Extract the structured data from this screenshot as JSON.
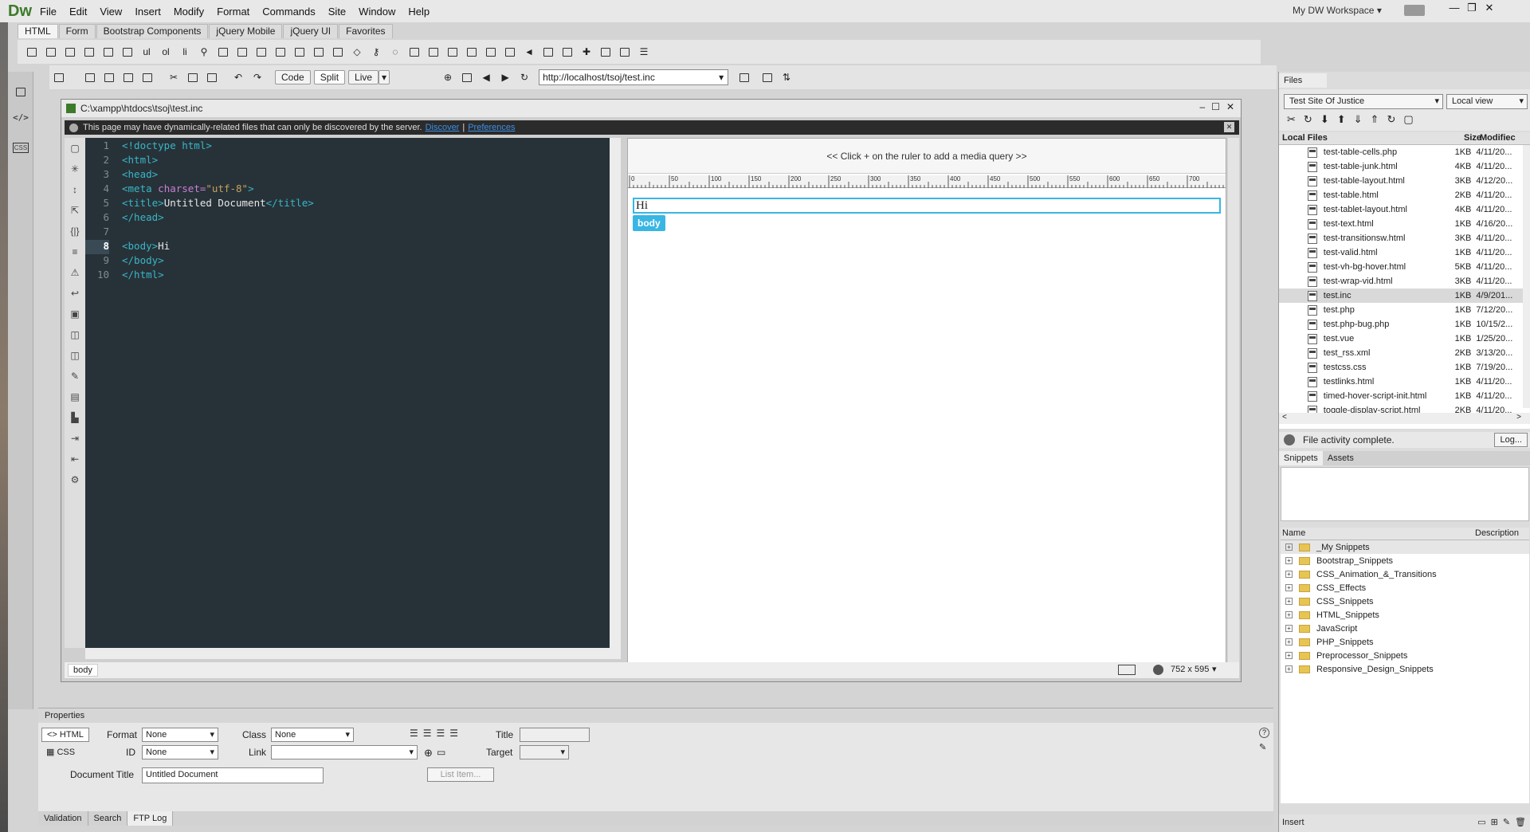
{
  "app": {
    "logo": "Dw",
    "workspace": "My DW Workspace"
  },
  "menu": [
    "File",
    "Edit",
    "View",
    "Insert",
    "Modify",
    "Format",
    "Commands",
    "Site",
    "Window",
    "Help"
  ],
  "insert_tabs": [
    "HTML",
    "Form",
    "Bootstrap Components",
    "jQuery Mobile",
    "jQuery UI",
    "Favorites"
  ],
  "insert_icons": {
    "ul": "ul",
    "ol": "ol",
    "li": "li"
  },
  "doc_toolbar": {
    "code": "Code",
    "split": "Split",
    "live": "Live",
    "url": "http://localhost/tsoj/test.inc"
  },
  "doc_window": {
    "path": "C:\\xampp\\htdocs\\tsoj\\test.inc",
    "info_text": "This page may have dynamically-related files that can only be discovered by the server.",
    "discover": "Discover",
    "sep": "|",
    "preferences": "Preferences"
  },
  "code": {
    "lines": [
      "1",
      "2",
      "3",
      "4",
      "5",
      "6",
      "7",
      "8",
      "9",
      "10"
    ],
    "doctype": "<!doctype html>",
    "html_open": "<html>",
    "head_open": "<head>",
    "meta_tag": "<meta",
    "meta_attr": "charset=",
    "meta_val": "\"utf-8\"",
    "meta_end": ">",
    "title_open": "<title>",
    "title_text": "Untitled Document",
    "title_close": "</title>",
    "head_close": "</head>",
    "body_open": "<body>",
    "body_text": "Hi",
    "body_close": "</body>",
    "html_close": "</html>"
  },
  "live": {
    "media_query": "<< Click + on the ruler to add a media query >>",
    "ruler": [
      "0",
      "50",
      "100",
      "150",
      "200",
      "250",
      "300",
      "350",
      "400",
      "450",
      "500",
      "550",
      "600",
      "650",
      "700"
    ],
    "content": "Hi",
    "tag": "body",
    "plus": "+"
  },
  "status": {
    "tag": "body",
    "size": "752 x 595"
  },
  "properties": {
    "title": "Properties",
    "html": "HTML",
    "css": "CSS",
    "format_label": "Format",
    "format_val": "None",
    "id_label": "ID",
    "id_val": "None",
    "class_label": "Class",
    "class_val": "None",
    "link_label": "Link",
    "link_val": "",
    "title_label": "Title",
    "target_label": "Target",
    "doc_title_label": "Document Title",
    "doc_title_val": "Untitled Document",
    "list_item": "List Item..."
  },
  "bottom_tabs": [
    "Validation",
    "Search",
    "FTP Log"
  ],
  "files": {
    "tab": "Files",
    "site": "Test Site Of Justice",
    "view": "Local view",
    "col_local": "Local Files",
    "col_size": "Size",
    "col_mod": "Modifiec",
    "rows": [
      {
        "name": "test-table-cells.php",
        "size": "1KB",
        "mod": "4/11/20..."
      },
      {
        "name": "test-table-junk.html",
        "size": "4KB",
        "mod": "4/11/20..."
      },
      {
        "name": "test-table-layout.html",
        "size": "3KB",
        "mod": "4/12/20..."
      },
      {
        "name": "test-table.html",
        "size": "2KB",
        "mod": "4/11/20..."
      },
      {
        "name": "test-tablet-layout.html",
        "size": "4KB",
        "mod": "4/11/20..."
      },
      {
        "name": "test-text.html",
        "size": "1KB",
        "mod": "4/16/20..."
      },
      {
        "name": "test-transitionsw.html",
        "size": "3KB",
        "mod": "4/11/20..."
      },
      {
        "name": "test-valid.html",
        "size": "1KB",
        "mod": "4/11/20..."
      },
      {
        "name": "test-vh-bg-hover.html",
        "size": "5KB",
        "mod": "4/11/20..."
      },
      {
        "name": "test-wrap-vid.html",
        "size": "3KB",
        "mod": "4/11/20..."
      },
      {
        "name": "test.inc",
        "size": "1KB",
        "mod": "4/9/201..."
      },
      {
        "name": "test.php",
        "size": "1KB",
        "mod": "7/12/20..."
      },
      {
        "name": "test.php-bug.php",
        "size": "1KB",
        "mod": "10/15/2..."
      },
      {
        "name": "test.vue",
        "size": "1KB",
        "mod": "1/25/20..."
      },
      {
        "name": "test_rss.xml",
        "size": "2KB",
        "mod": "3/13/20..."
      },
      {
        "name": "testcss.css",
        "size": "1KB",
        "mod": "7/19/20..."
      },
      {
        "name": "testlinks.html",
        "size": "1KB",
        "mod": "4/11/20..."
      },
      {
        "name": "timed-hover-script-init.html",
        "size": "1KB",
        "mod": "4/11/20..."
      },
      {
        "name": "toggle-display-script.html",
        "size": "2KB",
        "mod": "4/11/20..."
      }
    ],
    "selected_index": 10,
    "activity": "File activity complete.",
    "log": "Log..."
  },
  "snippets": {
    "tabs": [
      "Snippets",
      "Assets"
    ],
    "col_name": "Name",
    "col_desc": "Description",
    "folders": [
      "_My Snippets",
      "Bootstrap_Snippets",
      "CSS_Animation_&_Transitions",
      "CSS_Effects",
      "CSS_Snippets",
      "HTML_Snippets",
      "JavaScript",
      "PHP_Snippets",
      "Preprocessor_Snippets",
      "Responsive_Design_Snippets"
    ]
  },
  "insert_panel": "Insert"
}
